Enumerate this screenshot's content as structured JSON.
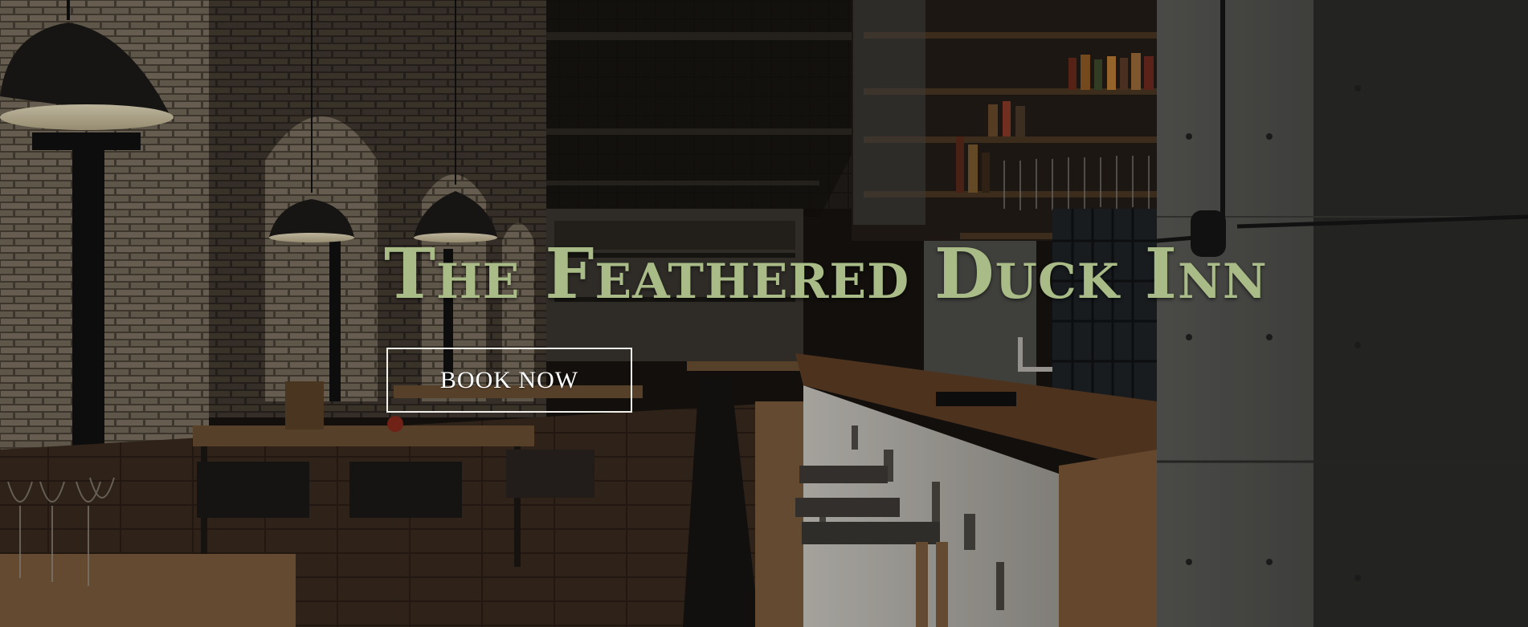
{
  "hero": {
    "title": "The Feathered Duck Inn",
    "book_now_label": "BOOK NOW"
  },
  "colors": {
    "title": "#a9bb86",
    "button_border": "#f2f0ea",
    "button_text": "#ffffff"
  }
}
